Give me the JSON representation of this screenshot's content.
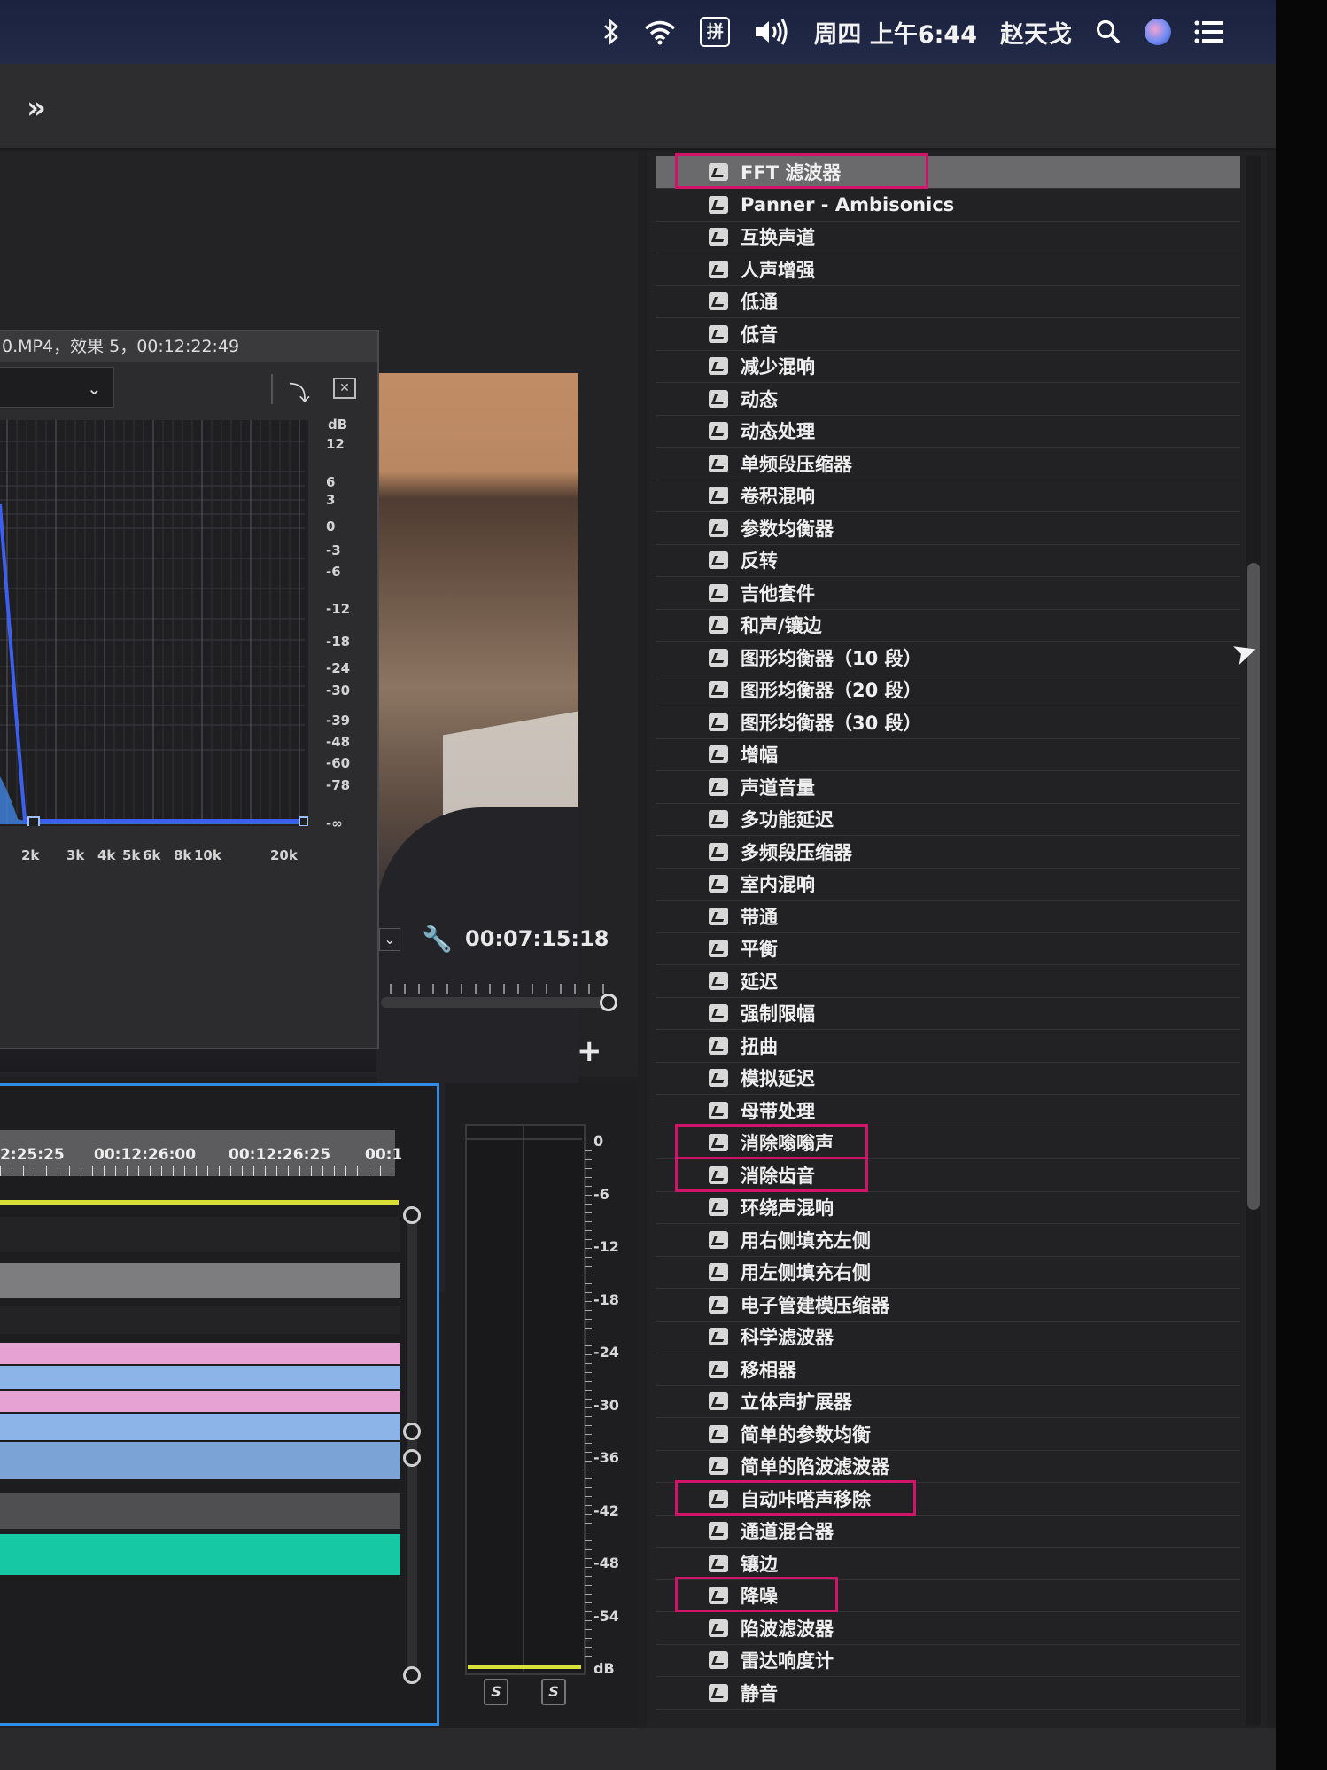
{
  "menubar": {
    "bluetooth_icon": "bluetooth-icon",
    "wifi_icon": "wifi-icon",
    "input_method": "拼",
    "volume_icon": "volume-icon",
    "datetime": "周四 上午6:44",
    "user": "赵天戈",
    "search_icon": "search-icon",
    "siri_icon": "siri-icon",
    "menu_icon": "notification-center-icon"
  },
  "toolbar": {
    "expand_label": "»"
  },
  "effect_editor": {
    "title": "0.MP4，效果 5，00:12:22:49",
    "db_unit": "dB",
    "db_ticks": [
      "12",
      "6",
      "3",
      "0",
      "-3",
      "-6",
      "-12",
      "-18",
      "-24",
      "-30",
      "-39",
      "-48",
      "-60",
      "-78",
      "-∞"
    ],
    "hz_ticks": [
      "2k",
      "3k",
      "4k",
      "5k",
      "6k",
      "8k",
      "10k",
      "20k"
    ]
  },
  "monitor": {
    "timecode": "00:07:15:18"
  },
  "timeline": {
    "ruler": [
      "2:25:25",
      "00:12:26:00",
      "00:12:26:25",
      "00:1"
    ],
    "tracks": [
      {
        "color": "#232325"
      },
      {
        "color": "#7d7d80"
      },
      {
        "color": "#232325"
      },
      {
        "color": "#e6a2d3"
      },
      {
        "color": "#8cb4e8"
      },
      {
        "color": "#e6a2d3"
      },
      {
        "color": "#8cb4e8"
      },
      {
        "color": "#7ba3d6"
      },
      {
        "color": "#4f4f52"
      },
      {
        "color": "#17c8a4"
      }
    ]
  },
  "meter": {
    "scale": [
      "0",
      "-6",
      "-12",
      "-18",
      "-24",
      "-30",
      "-36",
      "-42",
      "-48",
      "-54",
      "dB"
    ],
    "solo_left": "S",
    "solo_right": "S"
  },
  "effects": [
    "FFT 滤波器",
    "Panner - Ambisonics",
    "互换声道",
    "人声增强",
    "低通",
    "低音",
    "减少混响",
    "动态",
    "动态处理",
    "单频段压缩器",
    "卷积混响",
    "参数均衡器",
    "反转",
    "吉他套件",
    "和声/镶边",
    "图形均衡器（10 段）",
    "图形均衡器（20 段）",
    "图形均衡器（30 段）",
    "增幅",
    "声道音量",
    "多功能延迟",
    "多频段压缩器",
    "室内混响",
    "带通",
    "平衡",
    "延迟",
    "强制限幅",
    "扭曲",
    "模拟延迟",
    "母带处理",
    "消除嗡嗡声",
    "消除齿音",
    "环绕声混响",
    "用右侧填充左侧",
    "用左侧填充右侧",
    "电子管建模压缩器",
    "科学滤波器",
    "移相器",
    "立体声扩展器",
    "简单的参数均衡",
    "简单的陷波滤波器",
    "自动咔嗒声移除",
    "通道混合器",
    "镶边",
    "降噪",
    "陷波滤波器",
    "雷达响度计",
    "静音"
  ],
  "highlight_color": "#d0146a"
}
